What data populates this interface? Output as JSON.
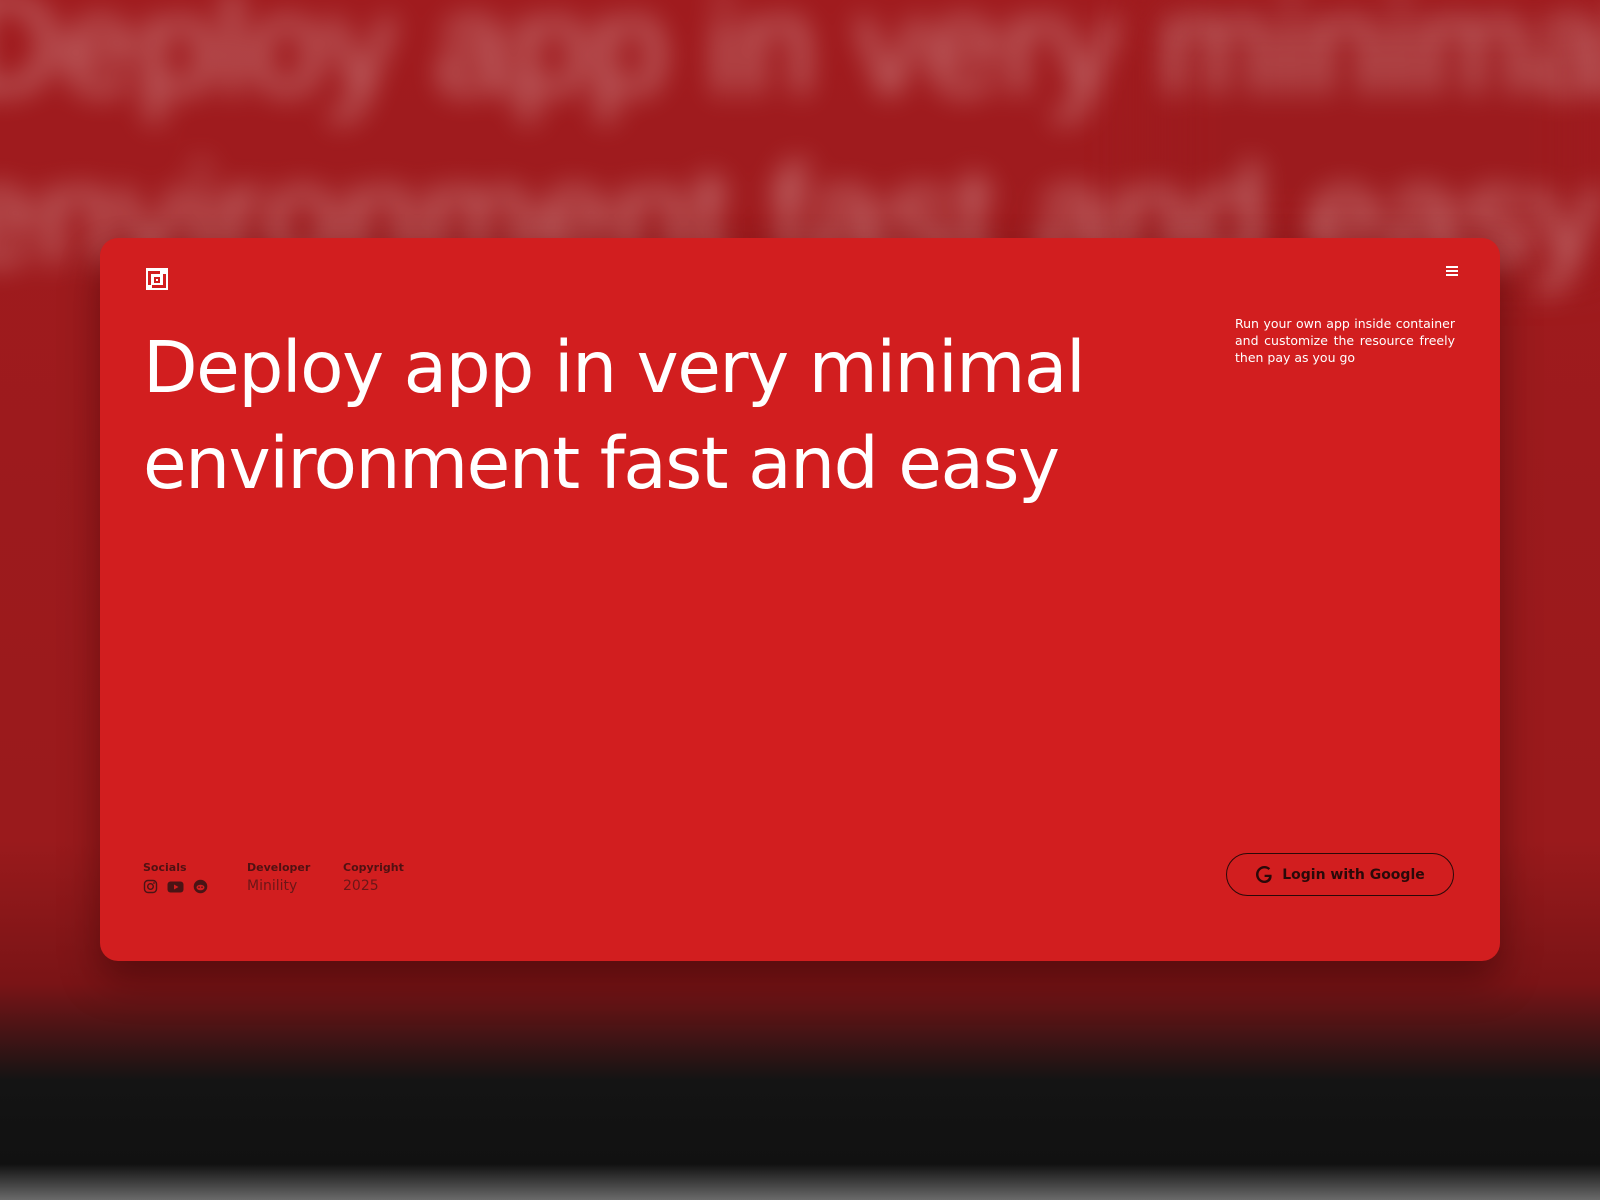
{
  "background": {
    "blurred_lines": [
      "Deploy app in very minimal",
      "environment fast and easy"
    ]
  },
  "header": {
    "logo_icon": "brand-logo-icon",
    "menu_icon": "hamburger-menu-icon"
  },
  "hero": {
    "headline_lines": [
      "Deploy app in very minimal",
      "environment fast and easy"
    ],
    "tagline": "Run your own app inside container and customize the resource freely then pay as you go"
  },
  "footer": {
    "socials": {
      "label": "Socials",
      "icons": [
        "instagram-icon",
        "youtube-icon",
        "reddit-icon"
      ]
    },
    "developer": {
      "label": "Developer",
      "value": "Minility"
    },
    "copyright": {
      "label": "Copyright",
      "value": "2025"
    }
  },
  "login": {
    "label": "Login with Google",
    "icon": "google-icon"
  },
  "colors": {
    "card_background": "#d21e1f",
    "text_light": "#ffffff",
    "text_dark": "#2a0909"
  }
}
